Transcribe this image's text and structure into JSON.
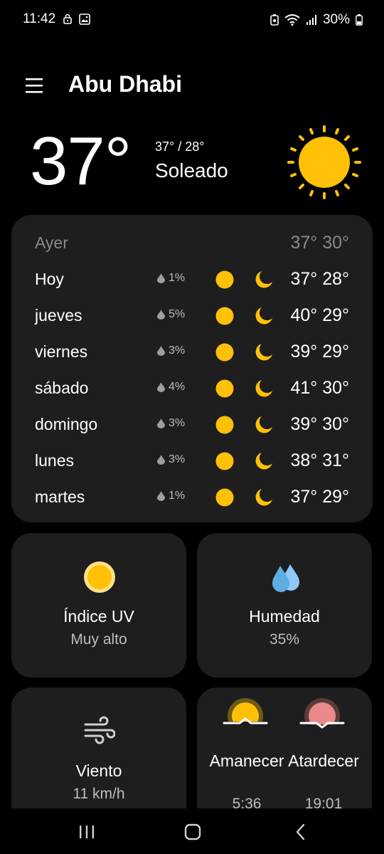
{
  "status_bar": {
    "time": "11:42",
    "battery": "30%",
    "icons": [
      "lock-icon",
      "image-icon",
      "battery-saver-icon",
      "wifi-icon",
      "signal-icon",
      "battery-icon"
    ]
  },
  "header": {
    "city": "Abu Dhabi",
    "menu_icon": "hamburger-menu-icon"
  },
  "current": {
    "temperature": "37°",
    "range": "37° / 28°",
    "condition": "Soleado",
    "icon": "sun-icon"
  },
  "forecast": {
    "yesterday": {
      "day": "Ayer",
      "temps": "37° 30°"
    },
    "days": [
      {
        "day": "Hoy",
        "rain": "1%",
        "temps": "37° 28°"
      },
      {
        "day": "jueves",
        "rain": "5%",
        "temps": "40° 29°"
      },
      {
        "day": "viernes",
        "rain": "3%",
        "temps": "39° 29°"
      },
      {
        "day": "sábado",
        "rain": "4%",
        "temps": "41° 30°"
      },
      {
        "day": "domingo",
        "rain": "3%",
        "temps": "39° 30°"
      },
      {
        "day": "lunes",
        "rain": "3%",
        "temps": "38° 31°"
      },
      {
        "day": "martes",
        "rain": "1%",
        "temps": "37° 29°"
      }
    ]
  },
  "tiles": {
    "uv": {
      "title": "Índice UV",
      "value": "Muy alto"
    },
    "humidity": {
      "title": "Humedad",
      "value": "35%"
    },
    "wind": {
      "title": "Viento",
      "value": "11 km/h"
    },
    "sunrise": {
      "title": "Amanecer",
      "value": "5:36"
    },
    "sunset": {
      "title": "Atardecer",
      "value": "19:01"
    }
  },
  "colors": {
    "sun": "#FFC107",
    "card": "#1E1E1E",
    "muted": "#BDBDBD",
    "sunset": "#E88A8A"
  }
}
